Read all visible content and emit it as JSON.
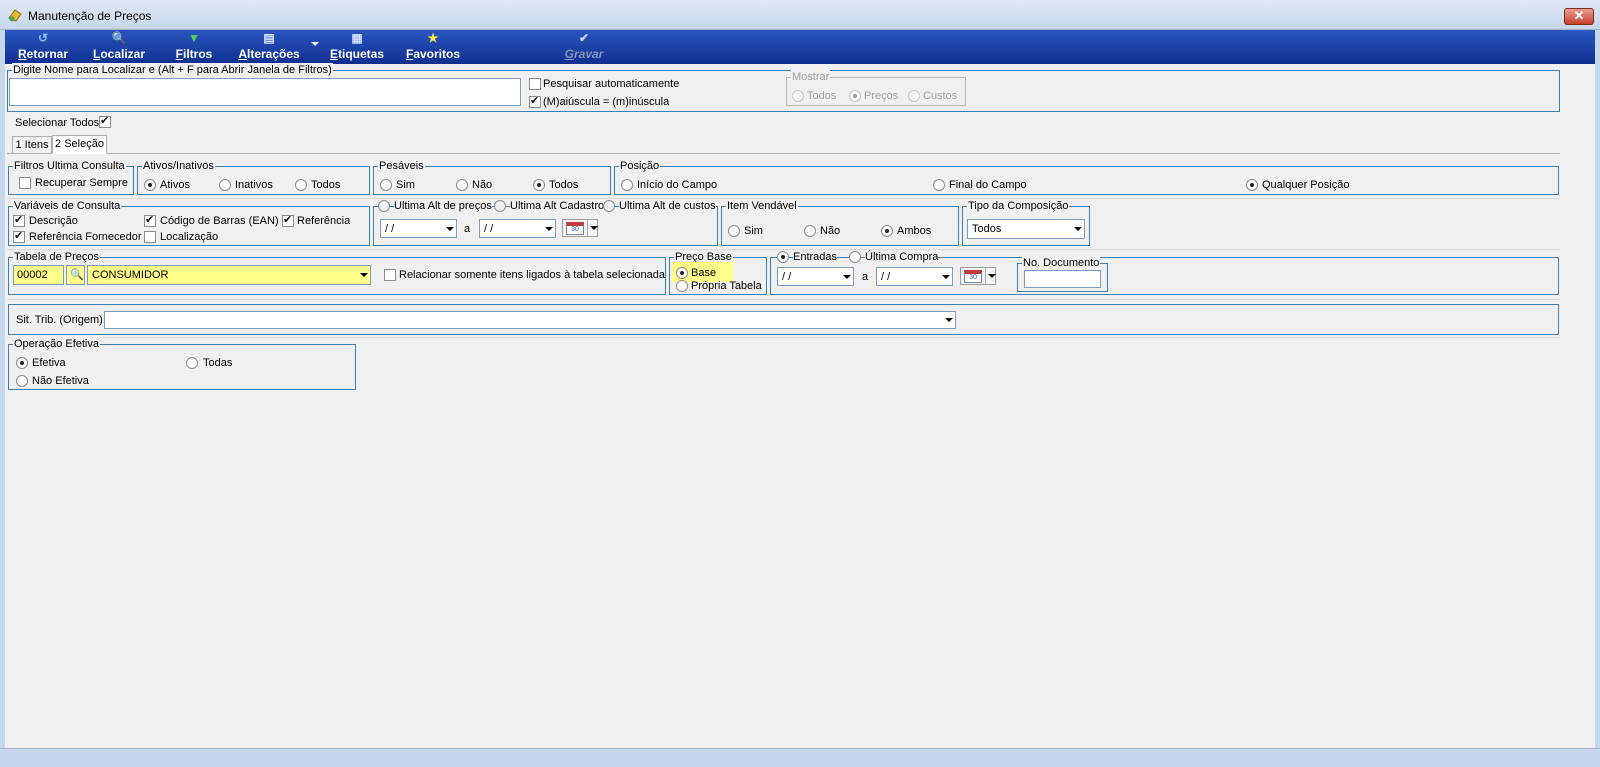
{
  "window": {
    "title": "Manutenção de Preços",
    "close": "✕"
  },
  "toolbar": {
    "retornar": "Retornar",
    "localizar": "Localizar",
    "filtros": "Filtros",
    "alteracoes": "Alterações",
    "etiquetas": "Etiquetas",
    "favoritos": "Favoritos",
    "gravar": "Gravar"
  },
  "search": {
    "group_title": "Digite Nome para Localizar e (Alt + F para Abrir Janela de Filtros)",
    "value": "",
    "auto_label": "Pesquisar automaticamente",
    "auto_checked": false,
    "case_label": "(M)aiúscula = (m)inúscula",
    "case_checked": true
  },
  "mostrar": {
    "title": "Mostrar",
    "options": [
      "Todos",
      "Preços",
      "Custos"
    ],
    "selected": "Preços"
  },
  "selecionar_todos": {
    "label": "Selecionar Todos",
    "checked": true
  },
  "tabs": [
    {
      "label": "1 Itens"
    },
    {
      "label": "2 Seleção",
      "active": true
    }
  ],
  "filtros_ultima": {
    "title": "Filtros Ultima Consulta",
    "recuperar": "Recuperar Sempre"
  },
  "ativos": {
    "title": "Ativos/Inativos",
    "options": [
      "Ativos",
      "Inativos",
      "Todos"
    ],
    "selected": "Ativos"
  },
  "pesaveis": {
    "title": "Pesáveis",
    "options": [
      "Sim",
      "Não",
      "Todos"
    ],
    "selected": "Todos"
  },
  "posicao": {
    "title": "Posição",
    "options": [
      "Início do Campo",
      "Final do Campo",
      "Qualquer Posição"
    ],
    "selected": "Qualquer Posição"
  },
  "variaveis": {
    "title": "Variáveis de Consulta",
    "descricao": "Descrição",
    "codigo_barras": "Código de Barras (EAN)",
    "referencia": "Referência",
    "ref_fornecedor": "Referência Fornecedor",
    "localizacao": "Localização"
  },
  "ultima_alt": {
    "options": [
      "Ultima Alt de preços",
      "Ultima Alt Cadastro",
      "Ultima Alt de custos"
    ],
    "date_from": "/ /",
    "date_to": "/ /",
    "a": "a",
    "cal": "30"
  },
  "item_vendavel": {
    "title": "Item Vendável",
    "options": [
      "Sim",
      "Não",
      "Ambos"
    ],
    "selected": "Ambos"
  },
  "tipo_composicao": {
    "title": "Tipo da Composição",
    "value": "Todos"
  },
  "tabela_precos": {
    "title": "Tabela de Preços",
    "codigo": "00002",
    "nome": "CONSUMIDOR",
    "relacionar": "Relacionar somente itens ligados à tabela selecionada"
  },
  "preco_base": {
    "title": "Preço Base",
    "options": [
      "Base",
      "Própria Tabela"
    ],
    "selected": "Base"
  },
  "entradas": {
    "options": [
      "Entradas",
      "Última Compra"
    ],
    "selected": "Entradas",
    "date_from": "/ /",
    "date_to": "/ /",
    "a": "a",
    "cal": "30"
  },
  "no_documento": {
    "title": "No. Documento",
    "value": ""
  },
  "sit_trib": {
    "label": "Sit. Trib. (Origem)",
    "value": ""
  },
  "operacao": {
    "title": "Operação Efetiva",
    "options": [
      "Efetiva",
      "Todas",
      "Não Efetiva"
    ],
    "selected": "Efetiva"
  }
}
